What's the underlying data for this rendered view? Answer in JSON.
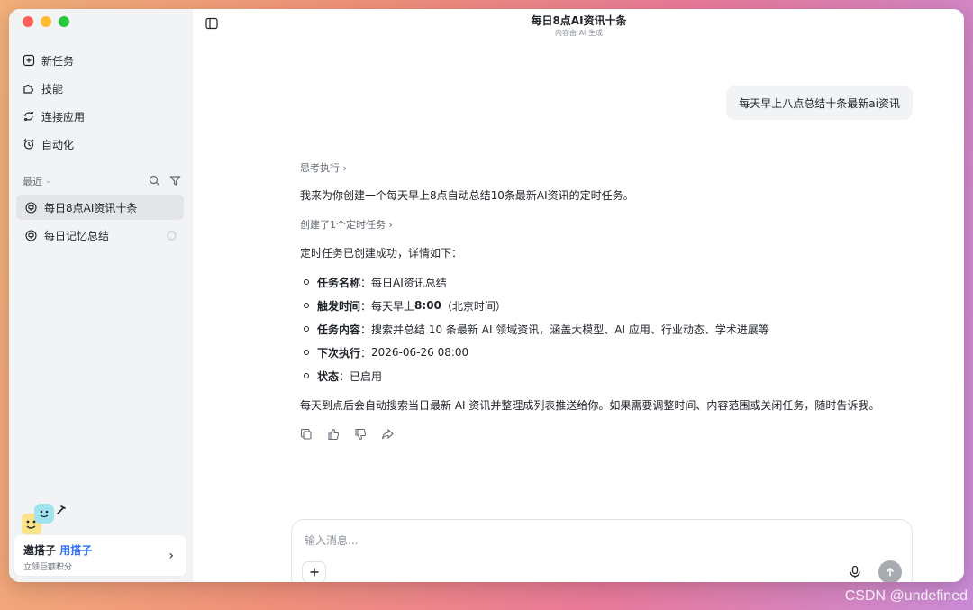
{
  "window": {
    "title": "每日8点AI资讯十条",
    "subtitle": "内容由 AI 生成"
  },
  "sidebar": {
    "nav": [
      {
        "label": "新任务",
        "icon": "new-task-icon"
      },
      {
        "label": "技能",
        "icon": "puzzle-icon"
      },
      {
        "label": "连接应用",
        "icon": "connect-icon"
      },
      {
        "label": "自动化",
        "icon": "alarm-clock-icon"
      }
    ],
    "recent_label": "最近",
    "conversations": [
      {
        "title": "每日8点AI资讯十条",
        "active": true
      },
      {
        "title": "每日记忆总结",
        "active": false
      }
    ],
    "promo": {
      "title_a": "邀搭子 ",
      "title_b": "用搭子",
      "subtitle": "立领巨额积分"
    }
  },
  "chat": {
    "user_message": "每天早上八点总结十条最新ai资讯",
    "thinking_label": "思考执行",
    "intro": "我来为你创建一个每天早上8点自动总结10条最新AI资讯的定时任务。",
    "scheduled_label": "创建了1个定时任务",
    "success": "定时任务已创建成功，详情如下：",
    "details": [
      {
        "key": "任务名称",
        "value": "每日AI资讯总结"
      },
      {
        "key": "触发时间",
        "value_prefix": "每天早上 ",
        "value_bold": "8:00",
        "value_suffix": "（北京时间）"
      },
      {
        "key": "任务内容",
        "value": "搜索并总结 10 条最新 AI 领域资讯，涵盖大模型、AI 应用、行业动态、学术进展等"
      },
      {
        "key": "下次执行",
        "value": "2026-06-26 08:00"
      },
      {
        "key": "状态",
        "value": "已启用"
      }
    ],
    "closing": "每天到点后会自动搜索当日最新 AI 资讯并整理成列表推送给你。如果需要调整时间、内容范围或关闭任务，随时告诉我。"
  },
  "composer": {
    "placeholder": "输入消息...",
    "value": ""
  },
  "watermark": "CSDN @undefined",
  "colors": {
    "accent": "#3370ff",
    "send_disabled": "#a8abb0",
    "sidebar_bg": "#f2f3f5"
  }
}
